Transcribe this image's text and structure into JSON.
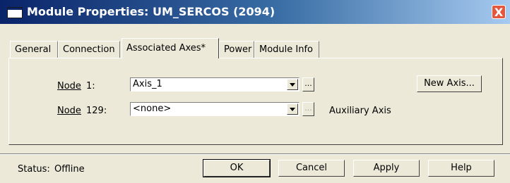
{
  "window": {
    "title": "Module Properties: UM_SERCOS (2094)",
    "close_label": "X"
  },
  "tabs": [
    {
      "label": "General"
    },
    {
      "label": "Connection"
    },
    {
      "label": "Associated Axes*"
    },
    {
      "label": "Power"
    },
    {
      "label": "Module Info"
    }
  ],
  "active_tab": "Associated Axes*",
  "nodes": [
    {
      "label_word": "Node",
      "number": "1:",
      "selected_value": "Axis_1",
      "ellipsis_label": "..."
    },
    {
      "label_word": "Node",
      "number": "129:",
      "selected_value": "<none>",
      "ellipsis_label": "...",
      "note": "Auxiliary Axis"
    }
  ],
  "new_axis_button": "New Axis...",
  "status": {
    "label": "Status:",
    "value": "Offline"
  },
  "footer_buttons": {
    "ok": "OK",
    "cancel": "Cancel",
    "apply": "Apply",
    "help": "Help"
  },
  "colors": {
    "title_bar_start": "#0a246a",
    "title_bar_end": "#a6caf0",
    "dialog_bg": "#ece9d8",
    "close_button": "#e4573c"
  }
}
